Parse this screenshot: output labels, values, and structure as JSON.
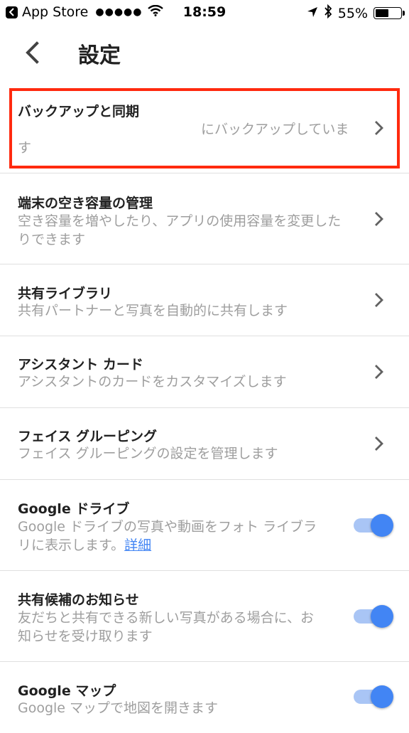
{
  "status_bar": {
    "back_app": "App Store",
    "signal": "●●●●●",
    "time": "18:59",
    "battery_percent": "55%",
    "battery_level": 0.55
  },
  "header": {
    "title": "設定"
  },
  "items": [
    {
      "title": "バックアップと同期",
      "subtitle_line1": "にバックアップしていま",
      "subtitle_line2": "す"
    },
    {
      "title": "端末の空き容量の管理",
      "subtitle_line1": "空き容量を増やしたり、アプリの使用容量を変更した",
      "subtitle_line2": "りできます"
    },
    {
      "title": "共有ライブラリ",
      "subtitle": "共有パートナーと写真を自動的に共有します"
    },
    {
      "title": "アシスタント カード",
      "subtitle": "アシスタントのカードをカスタマイズします"
    },
    {
      "title": "フェイス グルーピング",
      "subtitle": "フェイス グルーピングの設定を管理します"
    },
    {
      "title": "Google ドライブ",
      "subtitle_line1": "Google ドライブの写真や動画をフォト ライブラ",
      "subtitle_line2": "リに表示します。",
      "link": "詳細",
      "toggle_on": true
    },
    {
      "title": "共有候補のお知らせ",
      "subtitle_line1": "友だちと共有できる新しい写真がある場合に、お",
      "subtitle_line2": "知らせを受け取ります",
      "toggle_on": true
    },
    {
      "title": "Google マップ",
      "subtitle": "Google マップで地図を開きます",
      "toggle_on": true
    }
  ],
  "colors": {
    "accent": "#4285f4",
    "highlight": "#ff2a0f"
  }
}
